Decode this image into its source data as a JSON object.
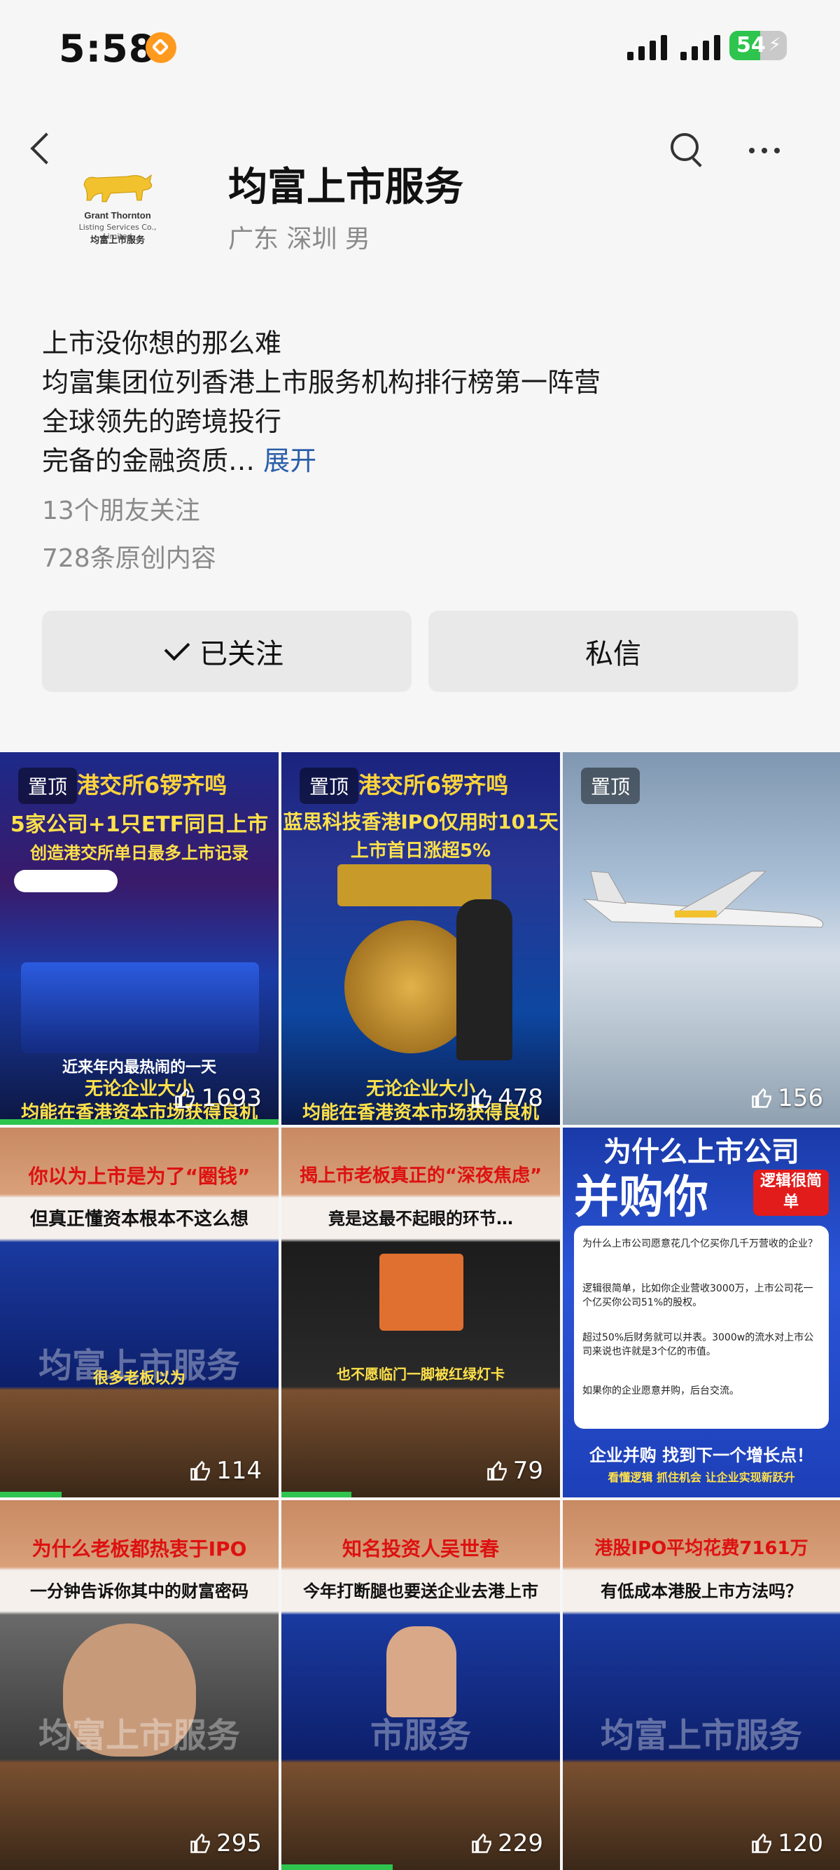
{
  "status_bar": {
    "time": "5:58",
    "battery": "54",
    "battery_level": 0.54
  },
  "profile": {
    "name": "均富上市服务",
    "location": "广东 深圳 男",
    "logo_text_1": "Grant Thornton",
    "logo_text_2": "Listing Services Co., Limited",
    "logo_text_3": "均富上市服务"
  },
  "bio": {
    "lines": [
      "上市没你想的那么难",
      "均富集团位列香港上市服务机构排行榜第一阵营",
      "全球领先的跨境投行",
      "完备的金融资质…"
    ],
    "expand_label": "展开"
  },
  "meta": {
    "friends": "13个朋友关注",
    "posts": "728条原创内容"
  },
  "actions": {
    "follow_label": "已关注",
    "message_label": "私信"
  },
  "colors": {
    "accent_link": "#2a5ea8",
    "progress": "#2ec44e",
    "button_bg": "#e9e9e9"
  },
  "videos": [
    {
      "pinned": "置顶",
      "title": "港交所6锣齐鸣",
      "line2": "5家公司+1只ETF同日上市",
      "line3": "创造港交所单日最多上市记录",
      "caption": "近来年内最热闹的一天",
      "bottom1": "无论企业大小",
      "bottom2": "均能在香港资本市场获得良机",
      "likes": "1693",
      "progress": 1.0
    },
    {
      "pinned": "置顶",
      "title": "港交所6锣齐鸣",
      "line2": "蓝思科技香港IPO仅用时101天",
      "line3": "上市首日涨超5%",
      "caption": "",
      "bottom1": "无论企业大小",
      "bottom2": "均能在香港资本市场获得良机",
      "likes": "478",
      "progress": 0
    },
    {
      "pinned": "置顶",
      "title": "",
      "line2": "",
      "line3": "",
      "caption": "",
      "bottom1": "",
      "bottom2": "",
      "likes": "156",
      "progress": 0
    },
    {
      "title": "你以为上市是为了“圈钱”",
      "line2": "但真正懂资本根本不这么想",
      "caption": "很多老板以为",
      "watermark": "均富上市服务",
      "likes": "114",
      "progress": 0.22
    },
    {
      "title": "揭上市老板真正的“深夜焦虑”",
      "line2": "竟是这最不起眼的环节…",
      "caption": "也不愿临门一脚被红绿灯卡",
      "likes": "79",
      "progress": 0.25
    },
    {
      "title": "为什么上市公司",
      "line2": "并购你",
      "badge": "逻辑很简单",
      "points": [
        "为什么上市公司愿意花几个亿买你几千万营收的企业？",
        "逻辑很简单，比如你企业营收3000万，上市公司花一个亿买你公司51%的股权。",
        "超过50%后财务就可以并表。3000w的流水对上市公司来说也许就是3个亿的市值。",
        "如果你的企业愿意并购，后台交流。"
      ],
      "footer": "企业并购 找到下一个增长点！",
      "footer2": "看懂逻辑 抓住机会 让企业实现新跃升",
      "likes": ""
    },
    {
      "title": "为什么老板都热衷于IPO",
      "line2": "一分钟告诉你其中的财富密码",
      "watermark": "均富上市服务",
      "likes": "295",
      "progress": 0
    },
    {
      "title": "知名投资人吴世春",
      "line2": "今年打断腿也要送企业去港上市",
      "watermark": "市服务",
      "likes": "229",
      "progress": 0.4
    },
    {
      "title": "港股IPO平均花费7161万",
      "line2": "有低成本港股上市方法吗？",
      "watermark": "均富上市服务",
      "likes": "120",
      "progress": 0
    }
  ]
}
